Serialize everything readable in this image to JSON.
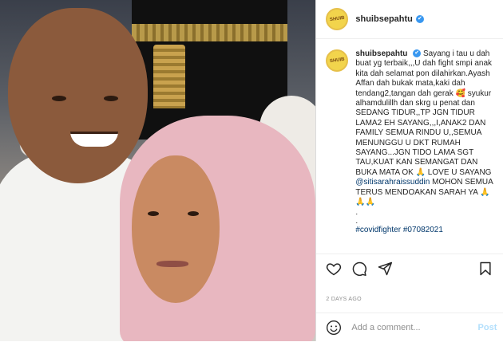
{
  "post": {
    "username": "shuibsepahtu",
    "avatar_text": "SHUIB",
    "verified_glyph": "✔",
    "caption": {
      "username": "shuibsepahtu",
      "text_before_mention": "Sayang i tau u dah buat yg terbaik,,,U dah fight smpi anak kita dah selamat pon dilahirkan.Ayash Affan dah bukak mata,kaki dah tendang2,tangan dah gerak 🥰 syukur alhamdulillh dan skrg u penat dan SEDANG TIDUR,,TP JGN TIDUR LAMA2 EH SAYANG,,,I,ANAK2 DAN FAMILY SEMUA RINDU U,,SEMUA MENUNGGU U DKT RUMAH SAYANG...JGN TIDO LAMA SGT TAU,KUAT KAN SEMANGAT DAN BUKA MATA OK 🙏 LOVE U SAYANG",
      "mention": "@sitisarahraissuddin",
      "text_after_mention": "MOHON SEMUA TERUS MENDOAKAN SARAH YA 🙏🙏🙏",
      "dot1": ".",
      "dot2": ".",
      "hashtags": "#covidfighter #07082021"
    },
    "time_ago": "2 DAYS AGO",
    "comment_placeholder": "Add a comment...",
    "post_button": "Post"
  },
  "icons": {
    "like": "heart-icon",
    "comment": "comment-icon",
    "share": "share-icon",
    "save": "bookmark-icon",
    "emoji": "emoji-icon",
    "verified": "verified-badge-icon"
  },
  "colors": {
    "verified": "#3897f0",
    "link": "#00376b",
    "post_disabled": "#b2dffc",
    "muted": "#8e8e8e"
  }
}
